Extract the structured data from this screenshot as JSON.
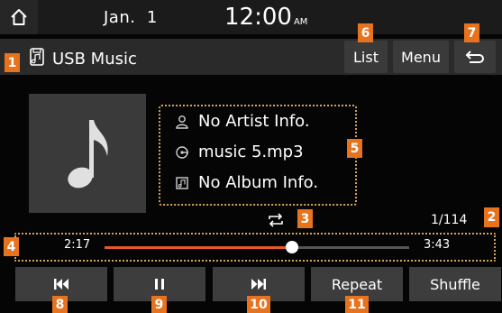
{
  "status_bar": {
    "date": "Jan.  1",
    "time": "12:00",
    "ampm": "AM"
  },
  "header": {
    "source_title": "USB Music",
    "list_label": "List",
    "menu_label": "Menu"
  },
  "track_info": {
    "artist": "No Artist Info.",
    "title": "music 5.mp3",
    "album": "No Album Info."
  },
  "track_counter": "1/114",
  "progress": {
    "elapsed": "2:17",
    "total": "3:43",
    "fraction": 0.614
  },
  "controls": {
    "repeat_label": "Repeat",
    "shuffle_label": "Shuffle"
  },
  "markers": [
    "1",
    "2",
    "3",
    "4",
    "5",
    "6",
    "7",
    "8",
    "9",
    "10",
    "11"
  ],
  "colors": {
    "accent": "#e8572a",
    "marker": "#e8731e",
    "frame": "#d2a35a",
    "button": "#3d3d3d"
  },
  "icons": [
    "home-icon",
    "usb-music-icon",
    "back-icon",
    "music-note-icon",
    "artist-icon",
    "song-icon",
    "album-icon",
    "repeat-icon",
    "previous-icon",
    "pause-icon",
    "next-icon"
  ]
}
